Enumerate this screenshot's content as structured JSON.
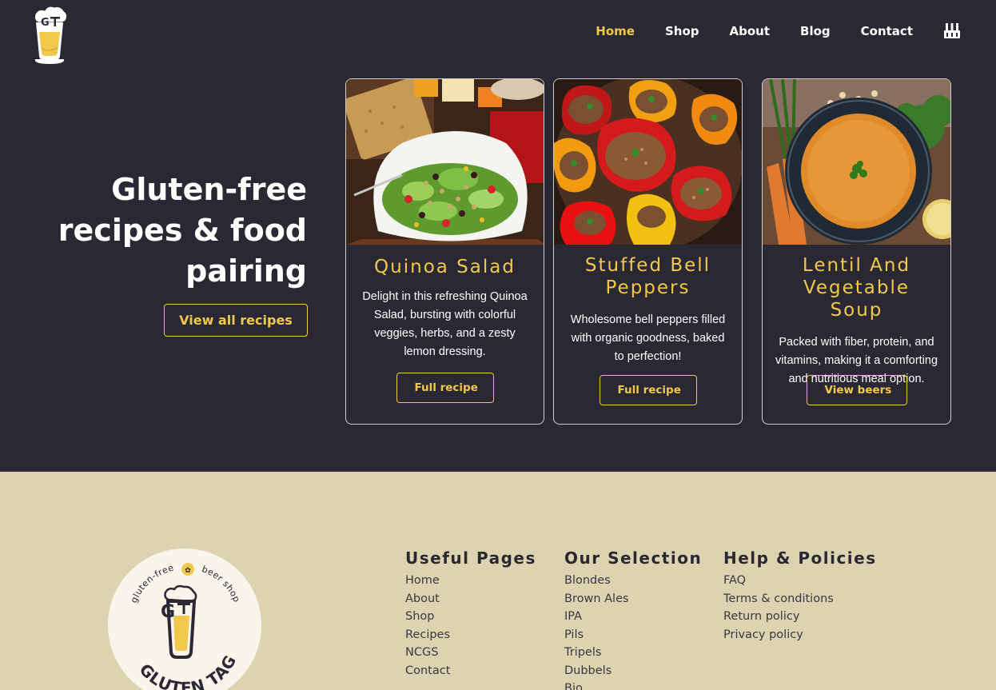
{
  "nav": {
    "items": [
      "Home",
      "Shop",
      "About",
      "Blog",
      "Contact"
    ],
    "active": "Home",
    "cart_icon": "beer-crate-icon"
  },
  "hero": {
    "title_line1": "Gluten-free",
    "title_line2": "recipes & food",
    "title_line3": "pairing",
    "button": "View all recipes"
  },
  "cards": [
    {
      "title_line1": "Quinoa Salad",
      "title_line2": "",
      "desc": "Delight in this refreshing Quinoa Salad, bursting with colorful veggies, herbs, and a zesty lemon dressing.",
      "button": "Full recipe",
      "image_icon": "quinoa-salad-photo"
    },
    {
      "title_line1": "Stuffed Bell",
      "title_line2": "Peppers",
      "desc": "Wholesome bell peppers filled with organic goodness, baked to perfection!",
      "button": "Full recipe",
      "image_icon": "stuffed-peppers-photo"
    },
    {
      "title_line1": "Lentil And",
      "title_line2": "Vegetable Soup",
      "desc": "Packed with fiber, protein, and vitamins, making it a comforting and nutritious meal option.",
      "button": "View beers",
      "image_icon": "lentil-soup-photo"
    }
  ],
  "footer": {
    "badge": {
      "top_left": "gluten-free",
      "top_right": "beer shop",
      "bottom": "GLUTEN TAG",
      "logo_letters": "GT"
    },
    "columns": [
      {
        "heading": "Useful Pages",
        "links": [
          "Home",
          "About",
          "Shop",
          "Recipes",
          "NCGS",
          "Contact"
        ]
      },
      {
        "heading": "Our Selection",
        "links": [
          "Blondes",
          "Brown Ales",
          "IPA",
          "Pils",
          "Tripels",
          "Dubbels",
          "Bio"
        ]
      },
      {
        "heading": "Help & Policies",
        "links": [
          "FAQ",
          "Terms & conditions",
          "Return policy",
          "Privacy policy"
        ]
      }
    ]
  },
  "colors": {
    "background": "#2a2833",
    "accent": "#f2c84b",
    "footer": "#dcd4b1"
  }
}
